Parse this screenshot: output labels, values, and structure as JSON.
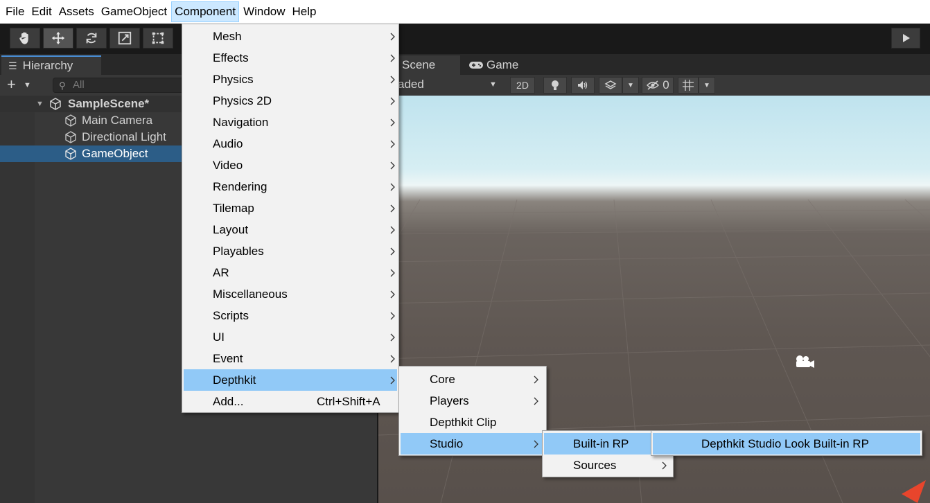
{
  "menubar": {
    "items": [
      "File",
      "Edit",
      "Assets",
      "GameObject",
      "Component",
      "Window",
      "Help"
    ],
    "active": "Component"
  },
  "toolbar": {
    "tools": [
      "hand-tool",
      "move-tool",
      "rotate-tool",
      "scale-tool",
      "rect-tool"
    ],
    "selected_tool": "move-tool"
  },
  "hierarchy": {
    "tab_label": "Hierarchy",
    "search_placeholder": "All",
    "scene_name": "SampleScene*",
    "objects": [
      "Main Camera",
      "Directional Light",
      "GameObject"
    ],
    "selected": "GameObject"
  },
  "scene_view": {
    "tabs": [
      "Scene",
      "Game"
    ],
    "shading_mode_visible": "aded",
    "two_d_label": "2D",
    "hidden_count": "0"
  },
  "component_menu": {
    "items": [
      "Mesh",
      "Effects",
      "Physics",
      "Physics 2D",
      "Navigation",
      "Audio",
      "Video",
      "Rendering",
      "Tilemap",
      "Layout",
      "Playables",
      "AR",
      "Miscellaneous",
      "Scripts",
      "UI",
      "Event",
      "Depthkit",
      "Add..."
    ],
    "highlighted": "Depthkit",
    "add_shortcut": "Ctrl+Shift+A"
  },
  "depthkit_menu": {
    "items": [
      "Core",
      "Players",
      "Depthkit Clip",
      "Studio"
    ],
    "highlighted": "Studio"
  },
  "studio_menu": {
    "items": [
      "Built-in RP",
      "Sources"
    ],
    "highlighted": "Built-in RP"
  },
  "builtin_menu": {
    "items": [
      "Depthkit Studio Look Built-in RP"
    ],
    "highlighted": "Depthkit Studio Look Built-in RP"
  },
  "colors": {
    "menu_highlight": "#91c9f7",
    "selection": "#2c5d87",
    "menu_bg": "#f2f2f2"
  }
}
